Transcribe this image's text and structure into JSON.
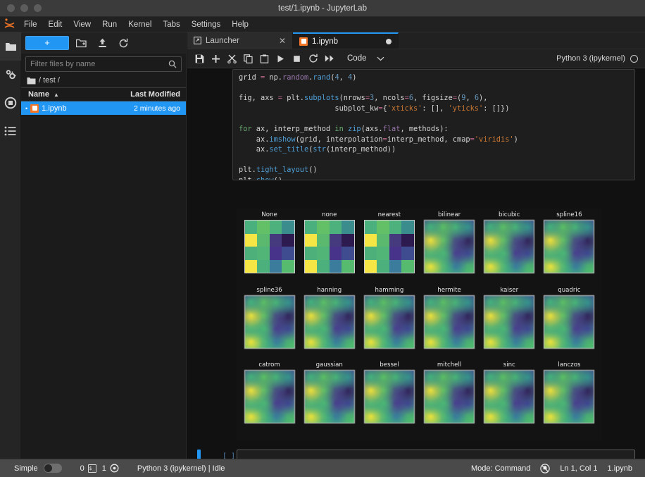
{
  "window": {
    "title": "test/1.ipynb - JupyterLab",
    "traffic_lights": [
      "close",
      "minimize",
      "zoom"
    ]
  },
  "menubar": {
    "logo": "jupyter-logo",
    "items": [
      "File",
      "Edit",
      "View",
      "Run",
      "Kernel",
      "Tabs",
      "Settings",
      "Help"
    ]
  },
  "activitybar": {
    "items": [
      {
        "name": "file-browser",
        "icon": "folder-icon",
        "active": true
      },
      {
        "name": "extension-manager",
        "icon": "puzzle-gears-icon",
        "active": false
      },
      {
        "name": "running-terminals-kernels",
        "icon": "stop-circle-icon",
        "active": false
      },
      {
        "name": "table-of-contents",
        "icon": "list-icon",
        "active": false
      }
    ]
  },
  "filebrowser": {
    "toolbar": {
      "new_launcher_label": "+",
      "new_folder_icon": "new-folder-icon",
      "upload_icon": "upload-icon",
      "refresh_icon": "refresh-icon"
    },
    "filter": {
      "placeholder": "Filter files by name",
      "value": "",
      "icon": "search-icon"
    },
    "breadcrumb": {
      "home_icon": "folder-icon",
      "path": "/ test /"
    },
    "columns": {
      "name": "Name",
      "last_modified": "Last Modified",
      "sort_indicator": "▲"
    },
    "rows": [
      {
        "name": "1.ipynb",
        "modified": "2 minutes ago",
        "icon": "notebook-icon",
        "selected": true
      }
    ]
  },
  "dock": {
    "tabs": [
      {
        "label": "Launcher",
        "icon": "launcher-icon",
        "active": false,
        "closable": true,
        "close_label": "✕"
      },
      {
        "label": "1.ipynb",
        "icon": "notebook-icon",
        "active": true,
        "dirty": true
      }
    ]
  },
  "notebook_toolbar": {
    "buttons": [
      {
        "name": "save-button",
        "icon": "save-icon"
      },
      {
        "name": "insert-cell-button",
        "icon": "plus-icon"
      },
      {
        "name": "cut-cell-button",
        "icon": "scissors-icon"
      },
      {
        "name": "copy-cell-button",
        "icon": "copy-icon"
      },
      {
        "name": "paste-cell-button",
        "icon": "paste-icon"
      },
      {
        "name": "run-cell-button",
        "icon": "play-icon"
      },
      {
        "name": "interrupt-kernel-button",
        "icon": "stop-icon"
      },
      {
        "name": "restart-kernel-button",
        "icon": "restart-icon"
      },
      {
        "name": "restart-run-all-button",
        "icon": "fast-forward-icon"
      }
    ],
    "cell_type": {
      "value": "Code",
      "chevron": "chevron-down-icon"
    },
    "kernel_name": "Python 3 (ipykernel)",
    "kernel_status_icon": "kernel-idle-circle"
  },
  "notebook": {
    "code_lines": [
      [
        {
          "t": "grid ",
          "c": "plain"
        },
        {
          "t": "=",
          "c": "op"
        },
        {
          "t": " np.",
          "c": "plain"
        },
        {
          "t": "random",
          "c": "mod"
        },
        {
          "t": ".",
          "c": "plain"
        },
        {
          "t": "rand",
          "c": "fn"
        },
        {
          "t": "(",
          "c": "plain"
        },
        {
          "t": "4",
          "c": "num"
        },
        {
          "t": ", ",
          "c": "plain"
        },
        {
          "t": "4",
          "c": "num"
        },
        {
          "t": ")",
          "c": "plain"
        }
      ],
      [
        {
          "t": "",
          "c": "plain"
        }
      ],
      [
        {
          "t": "fig, axs ",
          "c": "plain"
        },
        {
          "t": "=",
          "c": "op"
        },
        {
          "t": " plt.",
          "c": "plain"
        },
        {
          "t": "subplots",
          "c": "fn"
        },
        {
          "t": "(nrows",
          "c": "plain"
        },
        {
          "t": "=",
          "c": "op"
        },
        {
          "t": "3",
          "c": "num"
        },
        {
          "t": ", ncols",
          "c": "plain"
        },
        {
          "t": "=",
          "c": "op"
        },
        {
          "t": "6",
          "c": "num"
        },
        {
          "t": ", figsize",
          "c": "plain"
        },
        {
          "t": "=",
          "c": "op"
        },
        {
          "t": "(",
          "c": "plain"
        },
        {
          "t": "9",
          "c": "num"
        },
        {
          "t": ", ",
          "c": "plain"
        },
        {
          "t": "6",
          "c": "num"
        },
        {
          "t": "),",
          "c": "plain"
        }
      ],
      [
        {
          "t": "                      subplot_kw",
          "c": "plain"
        },
        {
          "t": "=",
          "c": "op"
        },
        {
          "t": "{",
          "c": "plain"
        },
        {
          "t": "'xticks'",
          "c": "str"
        },
        {
          "t": ": [], ",
          "c": "plain"
        },
        {
          "t": "'yticks'",
          "c": "str"
        },
        {
          "t": ": []})",
          "c": "plain"
        }
      ],
      [
        {
          "t": "",
          "c": "plain"
        }
      ],
      [
        {
          "t": "for",
          "c": "kw"
        },
        {
          "t": " ax, interp_method ",
          "c": "plain"
        },
        {
          "t": "in",
          "c": "kw"
        },
        {
          "t": " ",
          "c": "plain"
        },
        {
          "t": "zip",
          "c": "fn"
        },
        {
          "t": "(axs.",
          "c": "plain"
        },
        {
          "t": "flat",
          "c": "mod"
        },
        {
          "t": ", methods):",
          "c": "plain"
        }
      ],
      [
        {
          "t": "    ax.",
          "c": "plain"
        },
        {
          "t": "imshow",
          "c": "fn"
        },
        {
          "t": "(grid, interpolation",
          "c": "plain"
        },
        {
          "t": "=",
          "c": "op"
        },
        {
          "t": "interp_method, cmap",
          "c": "plain"
        },
        {
          "t": "=",
          "c": "op"
        },
        {
          "t": "'viridis'",
          "c": "str"
        },
        {
          "t": ")",
          "c": "plain"
        }
      ],
      [
        {
          "t": "    ax.",
          "c": "plain"
        },
        {
          "t": "set_title",
          "c": "fn"
        },
        {
          "t": "(",
          "c": "plain"
        },
        {
          "t": "str",
          "c": "fn"
        },
        {
          "t": "(interp_method))",
          "c": "plain"
        }
      ],
      [
        {
          "t": "",
          "c": "plain"
        }
      ],
      [
        {
          "t": "plt.",
          "c": "plain"
        },
        {
          "t": "tight_layout",
          "c": "fn"
        },
        {
          "t": "()",
          "c": "plain"
        }
      ],
      [
        {
          "t": "plt.",
          "c": "plain"
        },
        {
          "t": "show",
          "c": "fn"
        },
        {
          "t": "()",
          "c": "plain"
        }
      ]
    ],
    "empty_cell": {
      "prompt": "[ ]:",
      "value": "",
      "selected": true
    }
  },
  "chart_data": {
    "type": "heatmap",
    "title": "",
    "figure_background": "#131313",
    "colormap": "viridis",
    "nrows": 3,
    "ncols": 6,
    "figsize": [
      9,
      6
    ],
    "xlabel": "",
    "ylabel": "",
    "xticks": [],
    "yticks": [],
    "grid": false,
    "legend": "none",
    "panel_titles": [
      "None",
      "none",
      "nearest",
      "bilinear",
      "bicubic",
      "spline16",
      "spline36",
      "hanning",
      "hamming",
      "hermite",
      "kaiser",
      "quadric",
      "catrom",
      "gaussian",
      "bessel",
      "mitchell",
      "sinc",
      "lanczos"
    ],
    "shared_grid_values": [
      [
        0.52,
        0.58,
        0.55,
        0.4
      ],
      [
        0.95,
        0.55,
        0.15,
        0.05
      ],
      [
        0.52,
        0.53,
        0.18,
        0.28
      ],
      [
        0.95,
        0.52,
        0.35,
        0.55
      ]
    ],
    "shared_grid_colors": [
      [
        "#4ab07e",
        "#63c067",
        "#4cb17c",
        "#3a8d8c"
      ],
      [
        "#f5e545",
        "#5bb96f",
        "#463a7f",
        "#2d1a4f"
      ],
      [
        "#4db07b",
        "#52b578",
        "#47338a",
        "#3f4c8f"
      ],
      [
        "#f5e545",
        "#4cb07d",
        "#3b7b9c",
        "#56bb6e"
      ]
    ],
    "value_range": [
      0.0,
      1.0
    ],
    "description": "18 imshow panels of the same random 4x4 grid rendered with different matplotlib interpolation methods; first three (None, none, nearest) are blocky, the rest are smoothed."
  },
  "statusbar": {
    "simple_label": "Simple",
    "simple_on": false,
    "terminals_count": "0",
    "terminal_icon": "terminal-icon",
    "kernels_count": "1",
    "kernel_icon": "kernel-icon",
    "kernel_status": "Python 3 (ipykernel) | Idle",
    "mode": "Mode: Command",
    "notifications_icon": "notification-bell-off-icon",
    "cursor_position": "Ln 1, Col 1",
    "filename": "1.ipynb"
  },
  "colors": {
    "accent": "#2196f3",
    "jupyter_orange": "#f37726",
    "panel_bg": "#1b1b1b",
    "toolbar_bg": "#212121",
    "editor_bg": "#1e1e1e",
    "statusbar_bg": "#4a4a4a"
  }
}
